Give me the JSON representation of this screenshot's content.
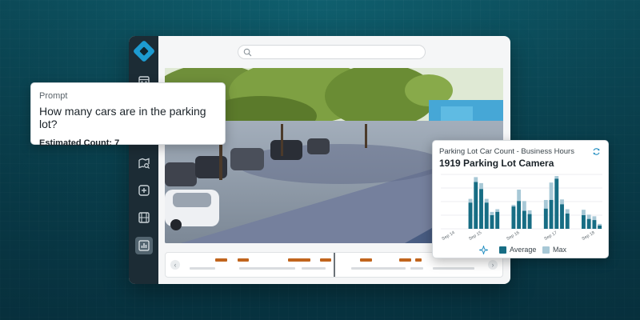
{
  "search": {
    "value": "",
    "placeholder": ""
  },
  "sidebar": {
    "icons": [
      "calendar-icon",
      "map-search-icon",
      "add-box-icon",
      "film-icon",
      "bar-chart-icon"
    ],
    "active": "bar-chart-icon"
  },
  "prompt": {
    "label": "Prompt",
    "question": "How many cars are in the parking lot?",
    "answer": "Estimated Count: 7"
  },
  "chart_card": {
    "subtitle": "Parking Lot Car Count - Business Hours",
    "title": "1919 Parking Lot Camera"
  },
  "colors": {
    "average": "#176d84",
    "max": "#a7c8d6",
    "timeline_event": "#c1651d",
    "logo": "#1d9bd1"
  },
  "chart_data": {
    "type": "bar",
    "x_tick_labels": [
      "Sep 14",
      "Sep 15",
      "Sep 16",
      "Sep 17",
      "Sep 18"
    ],
    "ylim": [
      0,
      1
    ],
    "grid": true,
    "legend_position": "bottom",
    "series": [
      {
        "name": "Average",
        "color": "#176d84",
        "values": [
          0,
          0,
          0,
          0,
          0,
          0.48,
          0.86,
          0.73,
          0.48,
          0.25,
          0.31,
          0,
          0,
          0.41,
          0.51,
          0.33,
          0.27,
          0,
          0,
          0.37,
          0.53,
          0.92,
          0.45,
          0.28,
          0,
          0,
          0.25,
          0.18,
          0.16,
          0.06
        ]
      },
      {
        "name": "Max",
        "color": "#a7c8d6",
        "values": [
          0,
          0,
          0,
          0,
          0,
          0.55,
          0.95,
          0.84,
          0.55,
          0.31,
          0.36,
          0,
          0,
          0.44,
          0.72,
          0.51,
          0.34,
          0,
          0,
          0.53,
          0.85,
          0.97,
          0.54,
          0.36,
          0,
          0,
          0.35,
          0.26,
          0.23,
          0.09
        ]
      }
    ],
    "legend": [
      "Average",
      "Max"
    ]
  }
}
